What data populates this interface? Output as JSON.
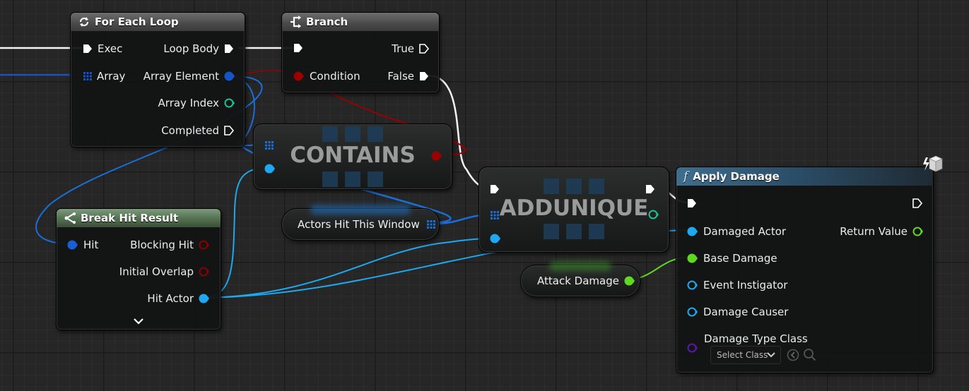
{
  "colors": {
    "exec": "#ffffff",
    "object": "#1ea8f0",
    "array": "#1453c8",
    "bool": "#a00000",
    "float": "#5fd821",
    "struct": "#0b3aa0",
    "class": "#5b16b0",
    "hitresult": "#2a6fd6"
  },
  "for_each_loop": {
    "title": "For Each Loop",
    "icon": "loop-icon",
    "inputs": {
      "exec": "Exec",
      "array": "Array"
    },
    "outputs": {
      "loop_body": "Loop Body",
      "array_element": "Array Element",
      "array_index": "Array Index",
      "completed": "Completed"
    }
  },
  "branch": {
    "title": "Branch",
    "icon": "branch-icon",
    "inputs": {
      "condition": "Condition"
    },
    "outputs": {
      "true": "True",
      "false": "False"
    }
  },
  "contains": {
    "title": "CONTAINS"
  },
  "addunique": {
    "title": "ADDUNIQUE"
  },
  "break_hit_result": {
    "title": "Break Hit Result",
    "icon": "break-struct-icon",
    "inputs": {
      "hit": "Hit"
    },
    "outputs": {
      "blocking_hit": "Blocking Hit",
      "initial_overlap": "Initial Overlap",
      "hit_actor": "Hit Actor"
    },
    "expand_icon": "chevron-down-icon"
  },
  "actors_hit_var": {
    "label": "Actors Hit This Window"
  },
  "attack_damage_var": {
    "label": "Attack Damage"
  },
  "apply_damage": {
    "title": "Apply Damage",
    "icon": "function-icon",
    "title_glyph": "f",
    "inputs": {
      "damaged_actor": "Damaged Actor",
      "base_damage": "Base Damage",
      "event_instigator": "Event Instigator",
      "damage_causer": "Damage Causer",
      "damage_type_class": "Damage Type Class"
    },
    "outputs": {
      "return_value": "Return Value"
    },
    "class_select": {
      "value": "Select Class"
    }
  }
}
